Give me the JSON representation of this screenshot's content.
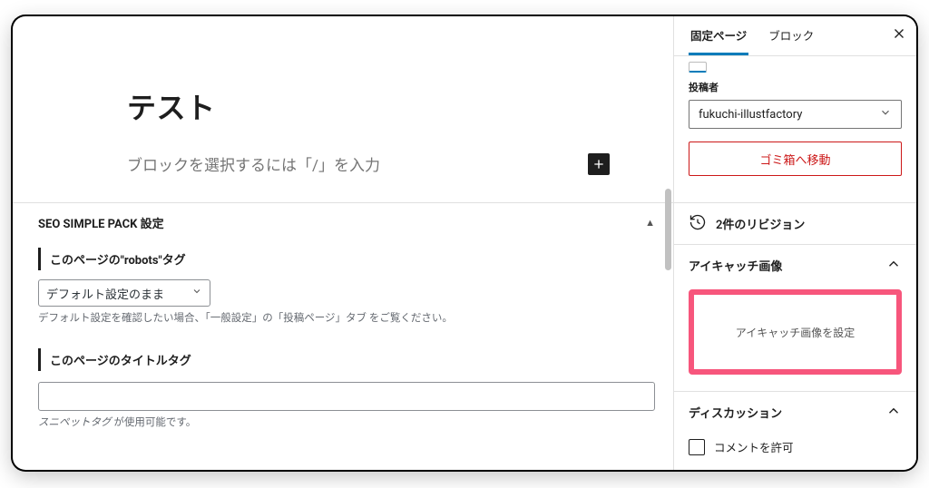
{
  "editor": {
    "title": "テスト",
    "block_placeholder": "ブロックを選択するには「/」を入力"
  },
  "seo_panel": {
    "heading": "SEO SIMPLE PACK 設定",
    "robots_label": "このページの\"robots\"タグ",
    "robots_value": "デフォルト設定のまま",
    "robots_help": "デフォルト設定を確認したい場合、「一般設定」の「投稿ページ」タブ をご覧ください。",
    "title_label": "このページのタイトルタグ",
    "title_value": "",
    "title_help_prefix": "スニペットタグ",
    "title_help_suffix": " が使用可能です。"
  },
  "sidebar": {
    "tab_page": "固定ページ",
    "tab_block": "ブロック",
    "author_label": "投稿者",
    "author_value": "fukuchi-illustfactory",
    "trash_label": "ゴミ箱へ移動",
    "revisions": "2件のリビジョン",
    "featured_heading": "アイキャッチ画像",
    "featured_button": "アイキャッチ画像を設定",
    "discussion_heading": "ディスカッション",
    "allow_comments": "コメントを許可"
  }
}
